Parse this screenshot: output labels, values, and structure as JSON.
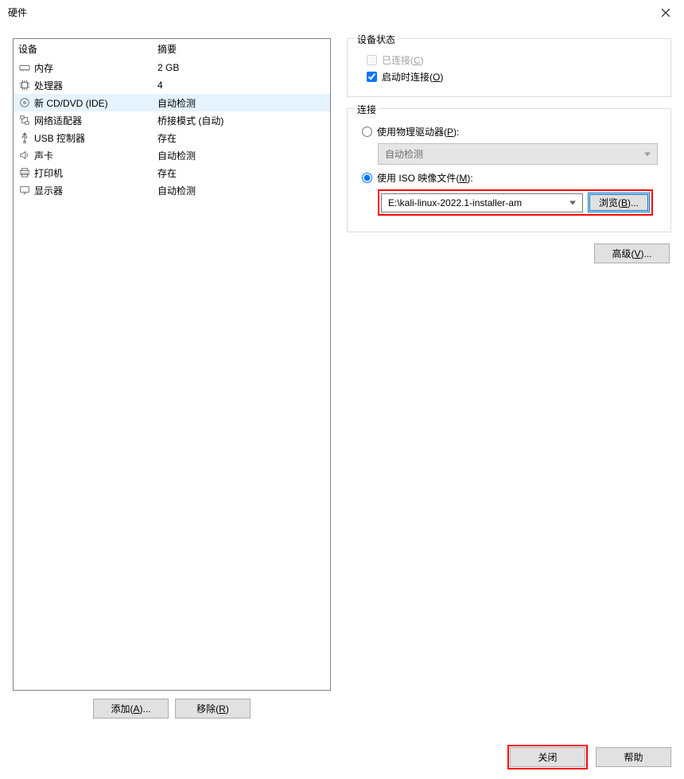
{
  "window": {
    "title": "硬件"
  },
  "device_table": {
    "col_device": "设备",
    "col_summary": "摘要",
    "rows": [
      {
        "icon": "memory-icon",
        "name": "内存",
        "summary": "2 GB"
      },
      {
        "icon": "cpu-icon",
        "name": "处理器",
        "summary": "4"
      },
      {
        "icon": "disc-icon",
        "name": "新 CD/DVD (IDE)",
        "summary": "自动检测",
        "selected": true
      },
      {
        "icon": "network-icon",
        "name": "网络适配器",
        "summary": "桥接模式 (自动)"
      },
      {
        "icon": "usb-icon",
        "name": "USB 控制器",
        "summary": "存在"
      },
      {
        "icon": "sound-icon",
        "name": "声卡",
        "summary": "自动检测"
      },
      {
        "icon": "printer-icon",
        "name": "打印机",
        "summary": "存在"
      },
      {
        "icon": "display-icon",
        "name": "显示器",
        "summary": "自动检测"
      }
    ]
  },
  "left_buttons": {
    "add_label_pre": "添加(",
    "add_hotkey": "A",
    "add_label_post": ")...",
    "remove_label_pre": "移除(",
    "remove_hotkey": "R",
    "remove_label_post": ")"
  },
  "status_group": {
    "title": "设备状态",
    "connected_pre": "已连接(",
    "connected_hotkey": "C",
    "connected_post": ")",
    "startup_pre": "启动时连接(",
    "startup_hotkey": "O",
    "startup_post": ")"
  },
  "connect_group": {
    "title": "连接",
    "physical_pre": "使用物理驱动器(",
    "physical_hotkey": "P",
    "physical_post": "):",
    "physical_combo": "自动检测",
    "iso_pre": "使用 ISO 映像文件(",
    "iso_hotkey": "M",
    "iso_post": "):",
    "iso_value": "E:\\kali-linux-2022.1-installer-am",
    "browse_pre": "浏览(",
    "browse_hotkey": "B",
    "browse_post": ")..."
  },
  "advanced": {
    "label_pre": "高级(",
    "label_hotkey": "V",
    "label_post": ")..."
  },
  "footer": {
    "close_label": "关闭",
    "help_label": "帮助"
  }
}
